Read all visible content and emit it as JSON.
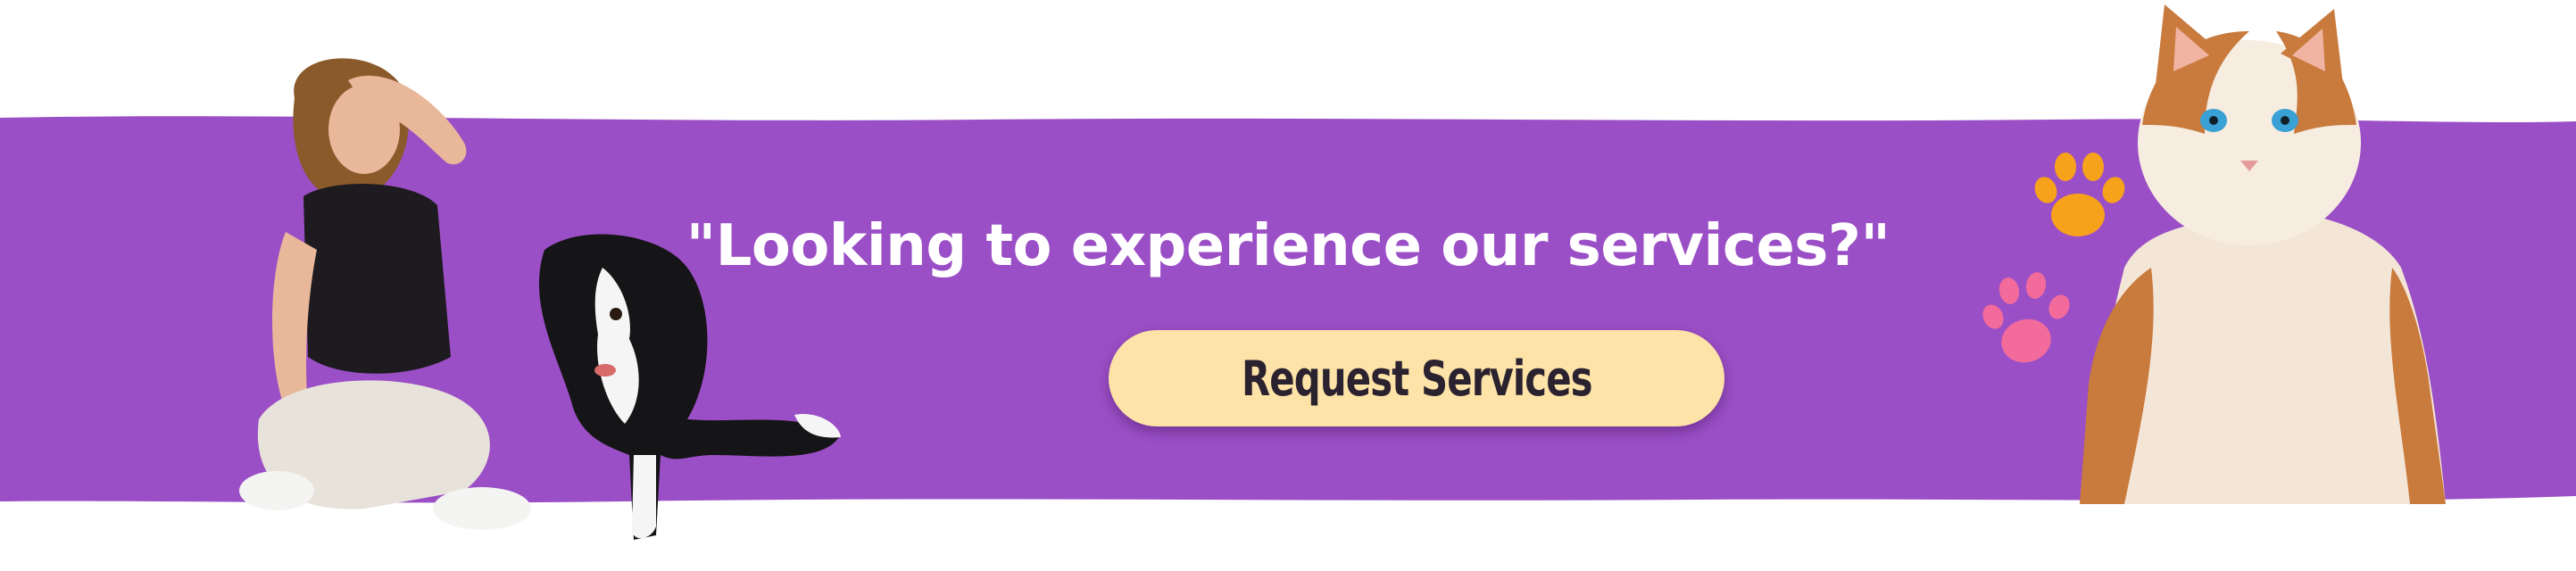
{
  "banner": {
    "headline": "\"Looking to experience our services?\"",
    "cta_label": "Request Services"
  },
  "colors": {
    "band": "#9b4fc6",
    "cta_background": "#fde3a7",
    "cta_text": "#2b2230",
    "headline": "#ffffff",
    "paw_orange": "#f7a21b",
    "paw_pink": "#f26b9b"
  },
  "images": {
    "woman_photo": "woman-sitting-laughing",
    "dog_photo": "black-white-border-collie",
    "cat_photo": "fluffy-ginger-white-cat",
    "paw_top": "paw-print-icon",
    "paw_bottom": "paw-print-icon"
  }
}
